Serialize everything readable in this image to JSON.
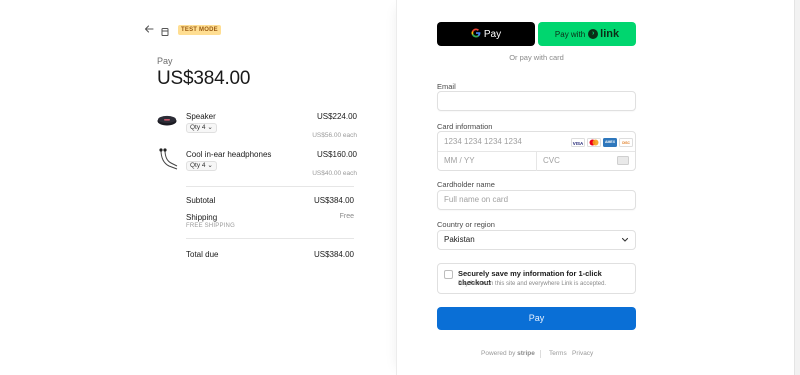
{
  "header": {
    "back_icon": "arrow-left-icon",
    "store_icon": "storefront-icon",
    "badge": "TEST MODE"
  },
  "summary": {
    "pay_label": "Pay",
    "amount": "US$384.00",
    "items": [
      {
        "name": "Speaker",
        "qty": "Qty 4",
        "price": "US$224.00",
        "each": "US$56.00 each",
        "icon": "speaker-image"
      },
      {
        "name": "Cool in-ear headphones",
        "qty": "Qty 4",
        "price": "US$160.00",
        "each": "US$40.00 each",
        "icon": "headphones-image"
      }
    ],
    "subtotal_label": "Subtotal",
    "subtotal_value": "US$384.00",
    "shipping_label": "Shipping",
    "shipping_sub": "FREE SHIPPING",
    "shipping_value": "Free",
    "total_label": "Total due",
    "total_value": "US$384.00"
  },
  "wallets": {
    "gpay_label": "Pay",
    "link_prefix": "Pay with",
    "link_brand": "link",
    "or_text": "Or pay with card"
  },
  "form": {
    "email_label": "Email",
    "email_placeholder": "",
    "card_label": "Card information",
    "card_number_placeholder": "1234 1234 1234 1234",
    "expiry_placeholder": "MM / YY",
    "cvc_placeholder": "CVC",
    "brands": [
      "VISA",
      "MC",
      "AMEX",
      "DISC"
    ],
    "name_label": "Cardholder name",
    "name_placeholder": "Full name on card",
    "country_label": "Country or region",
    "country_value": "Pakistan",
    "save_title": "Securely save my information for 1-click checkout",
    "save_sub": "Pay faster on this site and everywhere Link is accepted.",
    "pay_button": "Pay"
  },
  "footer": {
    "powered_prefix": "Powered by",
    "powered_brand": "stripe",
    "terms": "Terms",
    "privacy": "Privacy"
  },
  "colors": {
    "accent": "#0a6fd6",
    "link_green": "#00d66f",
    "badge_bg": "#ffde92"
  }
}
